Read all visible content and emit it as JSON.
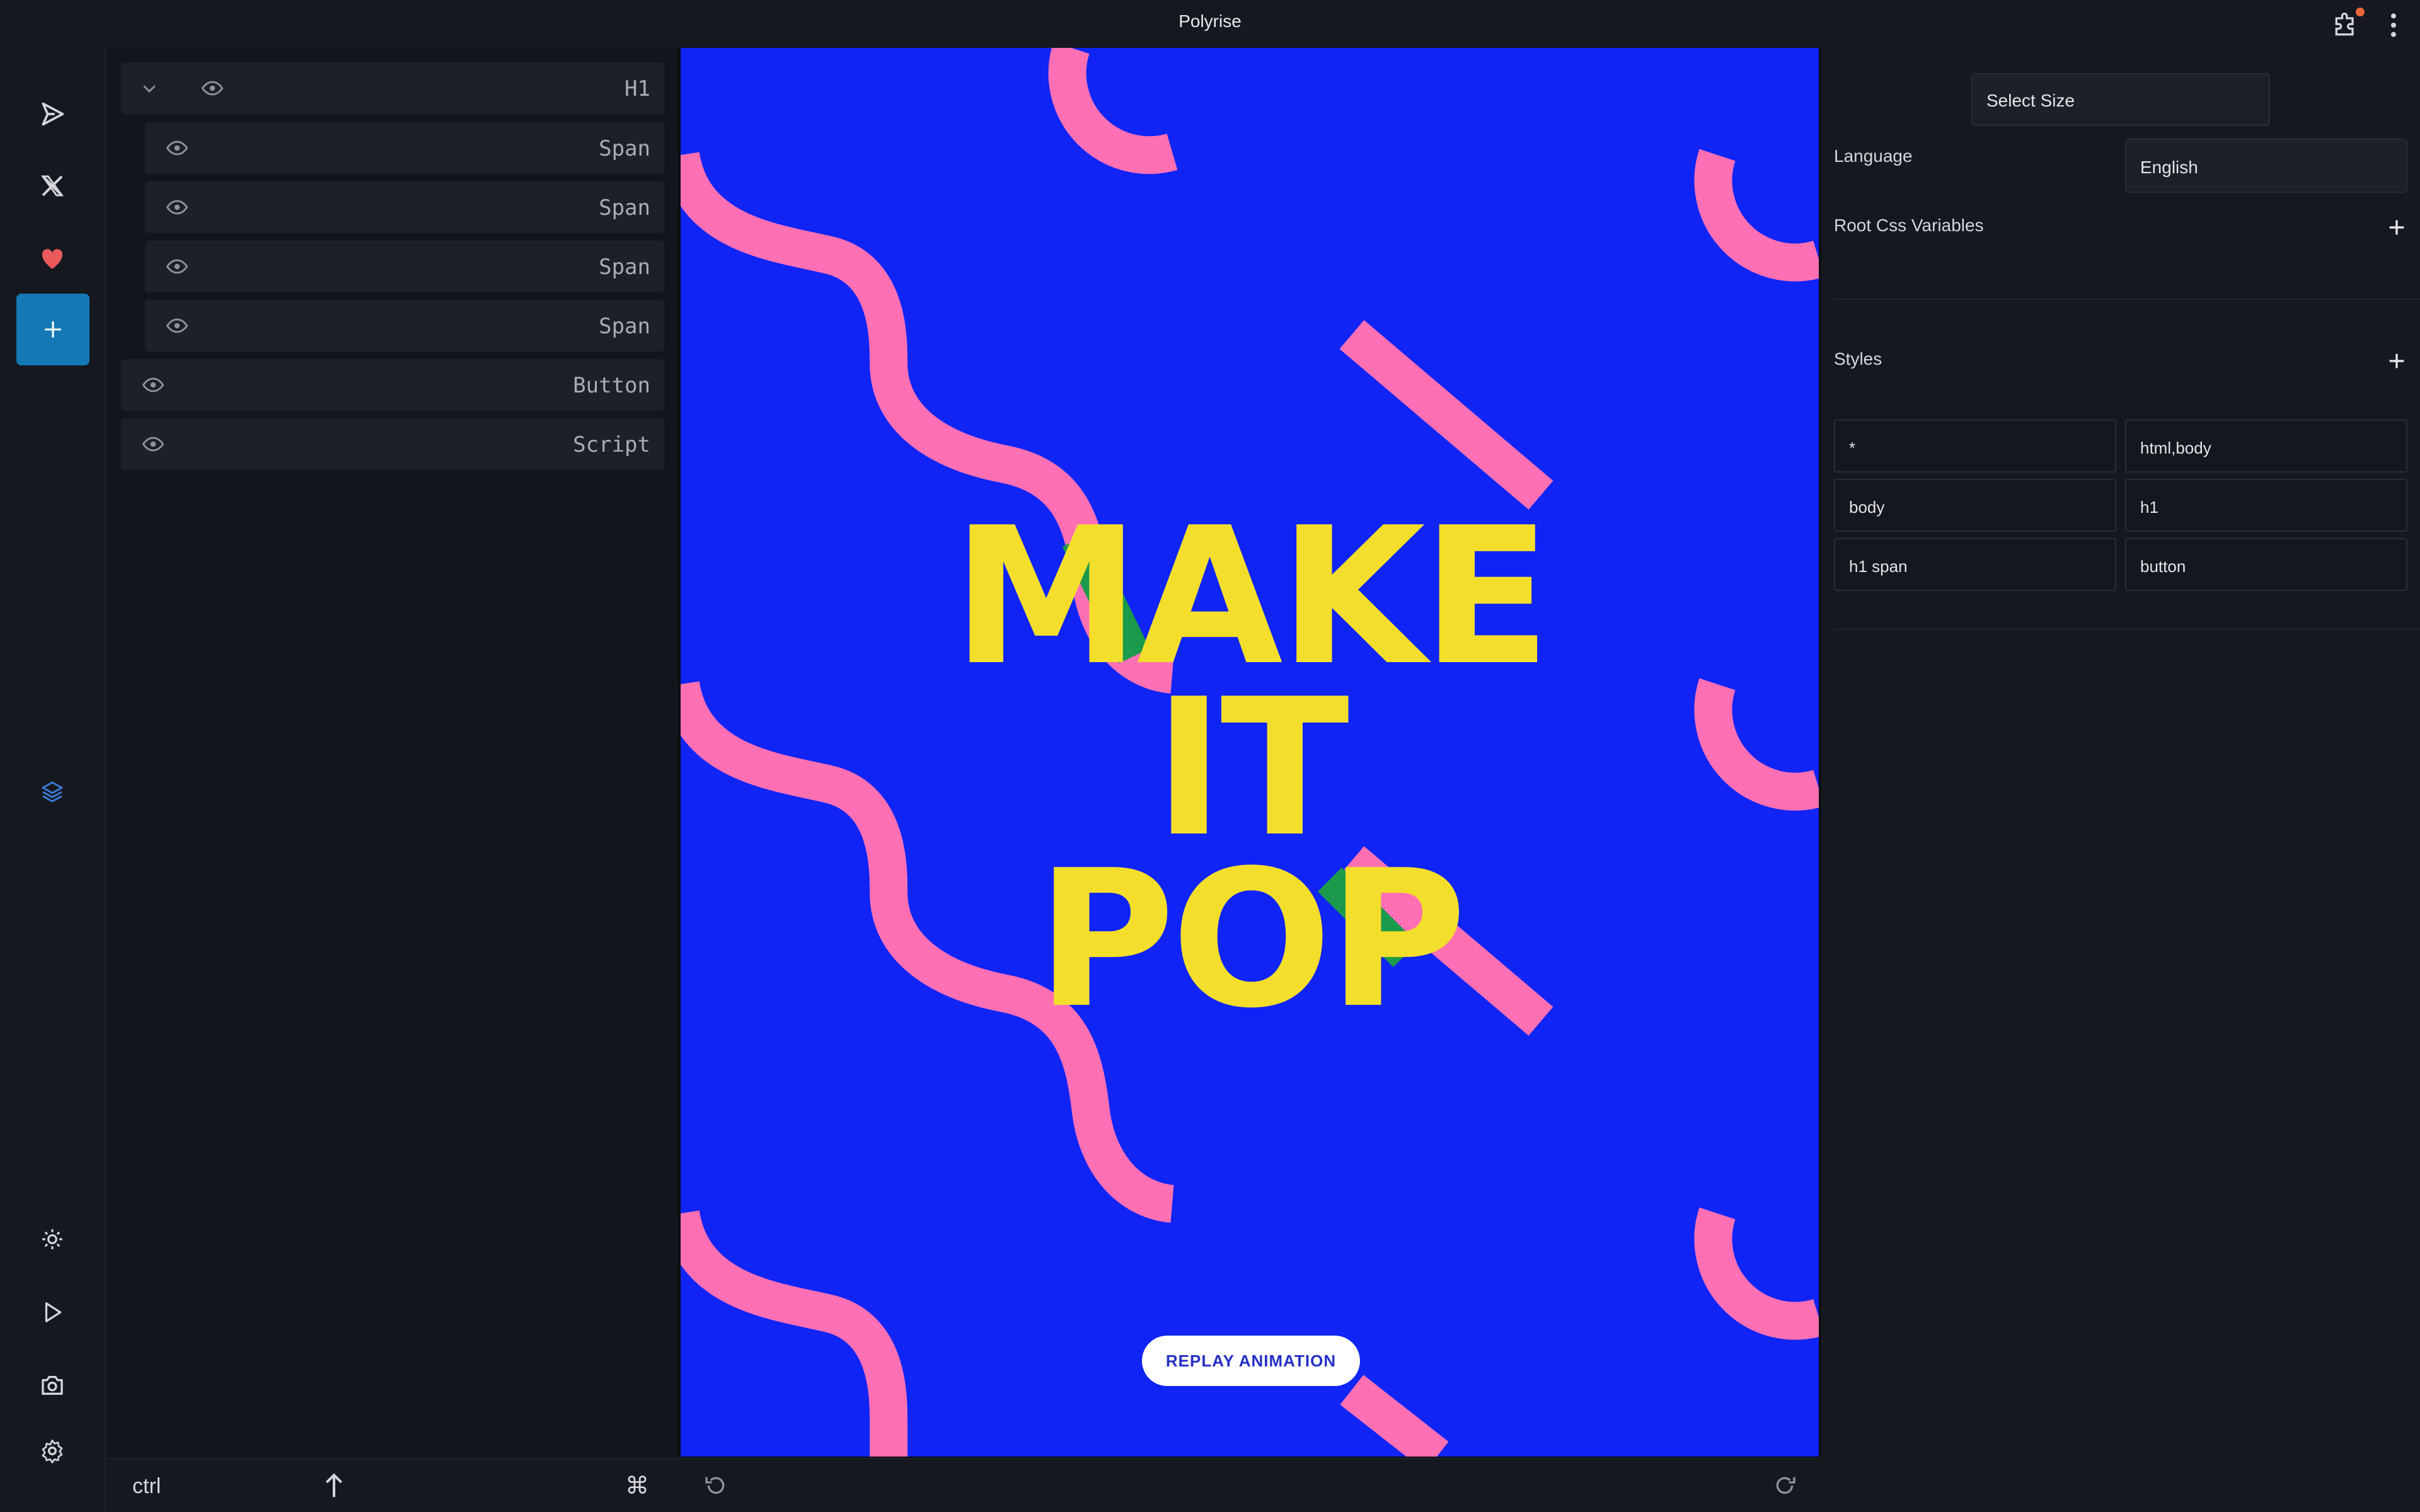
{
  "app": {
    "title": "Polyrise"
  },
  "layers": {
    "items": [
      {
        "label": "H1",
        "expanded": true
      },
      {
        "label": "Span"
      },
      {
        "label": "Span"
      },
      {
        "label": "Span"
      },
      {
        "label": "Span"
      },
      {
        "label": "Button"
      },
      {
        "label": "Script"
      }
    ]
  },
  "left_footer": {
    "ctrl_label": "ctrl",
    "cmd_symbol": "⌘"
  },
  "preview": {
    "headline_lines": [
      "MAKE",
      "IT",
      "POP"
    ],
    "replay_button": "REPLAY ANIMATION",
    "colors": {
      "background": "#0f24f5",
      "text": "#f4de2c",
      "accent_pink": "#ff6fb4",
      "accent_green": "#1a9a4a"
    }
  },
  "right_panel": {
    "select_size": "Select Size",
    "language_label": "Language",
    "language_value": "English",
    "root_css_label": "Root Css Variables",
    "styles_label": "Styles",
    "style_selectors": [
      "*",
      "html,body",
      "body",
      "h1",
      "h1 span",
      "button"
    ]
  },
  "rail_icons": [
    "send-icon",
    "x-logo-icon",
    "heart-icon",
    "add-icon",
    "layers-icon",
    "sun-icon",
    "play-icon",
    "camera-icon",
    "settings-icon"
  ],
  "theme": {
    "accent": "#1479b6",
    "heart": "#ea5a5a",
    "layers_icon": "#3b7bd6"
  }
}
